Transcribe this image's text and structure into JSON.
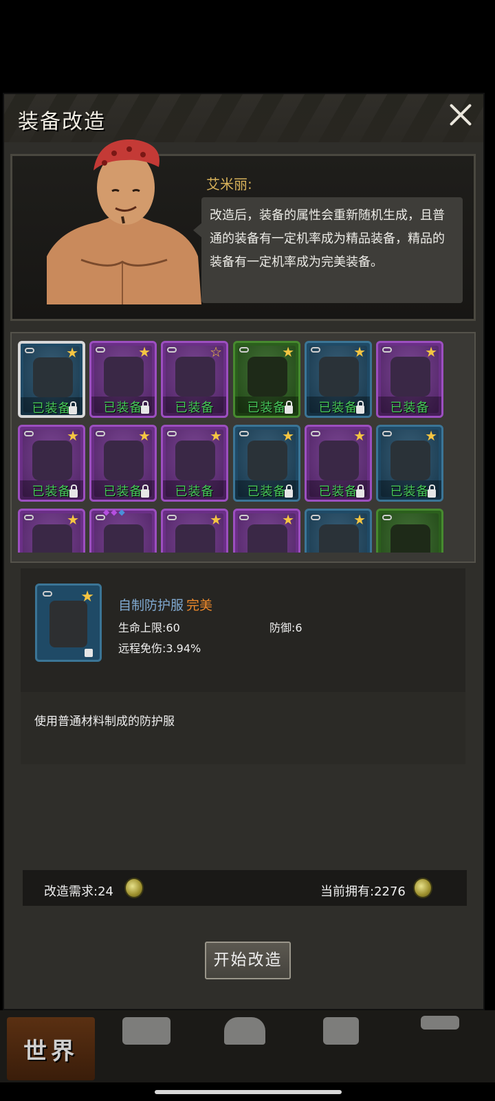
{
  "panel": {
    "title": "装备改造"
  },
  "dialog": {
    "npc_name": "艾米丽:",
    "text": "改造后，装备的属性会重新随机生成，且普通的装备有一定机率成为精品装备，精品的装备有一定机率成为完美装备。"
  },
  "grid": {
    "equipped_label": "已装备",
    "items": [
      {
        "icon": "tactical-vest-icon",
        "rarity": "blue",
        "star": "filled",
        "equipped": true,
        "selected": true
      },
      {
        "icon": "plate-carrier-icon",
        "rarity": "purple",
        "star": "filled",
        "equipped": true
      },
      {
        "icon": "gas-mask-icon",
        "rarity": "purple",
        "star": "outline",
        "equipped": false
      },
      {
        "icon": "face-mask-icon",
        "rarity": "green",
        "star": "filled",
        "equipped": true
      },
      {
        "icon": "sunglasses-icon",
        "rarity": "blue",
        "star": "filled",
        "equipped": true
      },
      {
        "icon": "camo-boots-icon",
        "rarity": "purple",
        "star": "filled",
        "equipped": false
      },
      {
        "icon": "yellow-boots-icon",
        "rarity": "purple",
        "star": "filled",
        "equipped": true
      },
      {
        "icon": "black-pants-icon",
        "rarity": "purple",
        "star": "filled",
        "equipped": true
      },
      {
        "icon": "camo-pants-icon",
        "rarity": "purple",
        "star": "filled",
        "equipped": false
      },
      {
        "icon": "yellow-pants-icon",
        "rarity": "blue",
        "star": "filled",
        "equipped": true
      },
      {
        "icon": "black-sweater-icon",
        "rarity": "purple",
        "star": "filled",
        "equipped": true
      },
      {
        "icon": "grey-shirt-icon",
        "rarity": "blue",
        "star": "filled",
        "equipped": true
      },
      {
        "icon": "jacket-icon",
        "rarity": "purple",
        "star": "filled",
        "equipped": false
      },
      {
        "icon": "fur-coat-icon",
        "rarity": "purple",
        "star": "none",
        "equipped": false
      },
      {
        "icon": "yellow-hoodie-icon",
        "rarity": "purple",
        "star": "filled",
        "equipped": false
      },
      {
        "icon": "combat-helmet-icon",
        "rarity": "purple",
        "star": "filled",
        "equipped": false
      },
      {
        "icon": "helmet-icon",
        "rarity": "blue",
        "star": "filled",
        "equipped": false
      },
      {
        "icon": "rifle-icon",
        "rarity": "green",
        "star": "none",
        "equipped": false
      }
    ]
  },
  "detail": {
    "name": "自制防护服",
    "quality": "完美",
    "stats": {
      "hp_max": "生命上限:60",
      "defense": "防御:6",
      "ranged_reduction": "远程免伤:3.94%"
    },
    "description": "使用普通材料制成的防护服"
  },
  "cost": {
    "required_label": "改造需求:24",
    "owned_label": "当前拥有:2276"
  },
  "start_button": "开始改造",
  "nav": {
    "world": "世界"
  },
  "colors": {
    "equipped": "#47c85a",
    "quality_perfect": "#f08a2b",
    "item_name": "#7fa8cf",
    "npc_name": "#d8b25a"
  }
}
